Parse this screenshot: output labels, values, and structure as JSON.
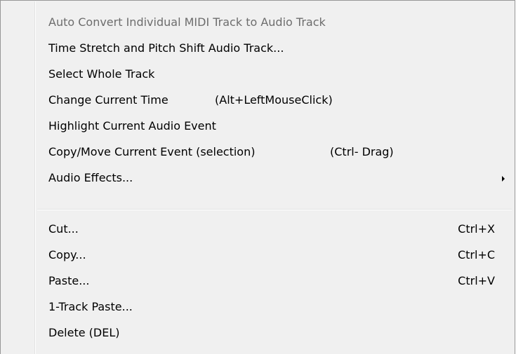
{
  "menu": {
    "items": [
      {
        "label": "Auto Convert Individual MIDI Track to Audio Track",
        "disabled": true
      },
      {
        "label": "Time Stretch and Pitch Shift Audio Track..."
      },
      {
        "label": "Select Whole Track"
      },
      {
        "label": "Change Current Time",
        "hint": "(Alt+LeftMouseClick)"
      },
      {
        "label": "Highlight Current Audio Event"
      },
      {
        "label": "Copy/Move Current Event (selection)",
        "hint": "(Ctrl- Drag)"
      },
      {
        "label": "Audio Effects...",
        "submenu": true
      },
      {
        "label": "Cut...",
        "shortcut": "Ctrl+X"
      },
      {
        "label": "Copy...",
        "shortcut": "Ctrl+C"
      },
      {
        "label": "Paste...",
        "shortcut": "Ctrl+V"
      },
      {
        "label": "1-Track Paste..."
      },
      {
        "label": "Delete (DEL)"
      }
    ]
  }
}
